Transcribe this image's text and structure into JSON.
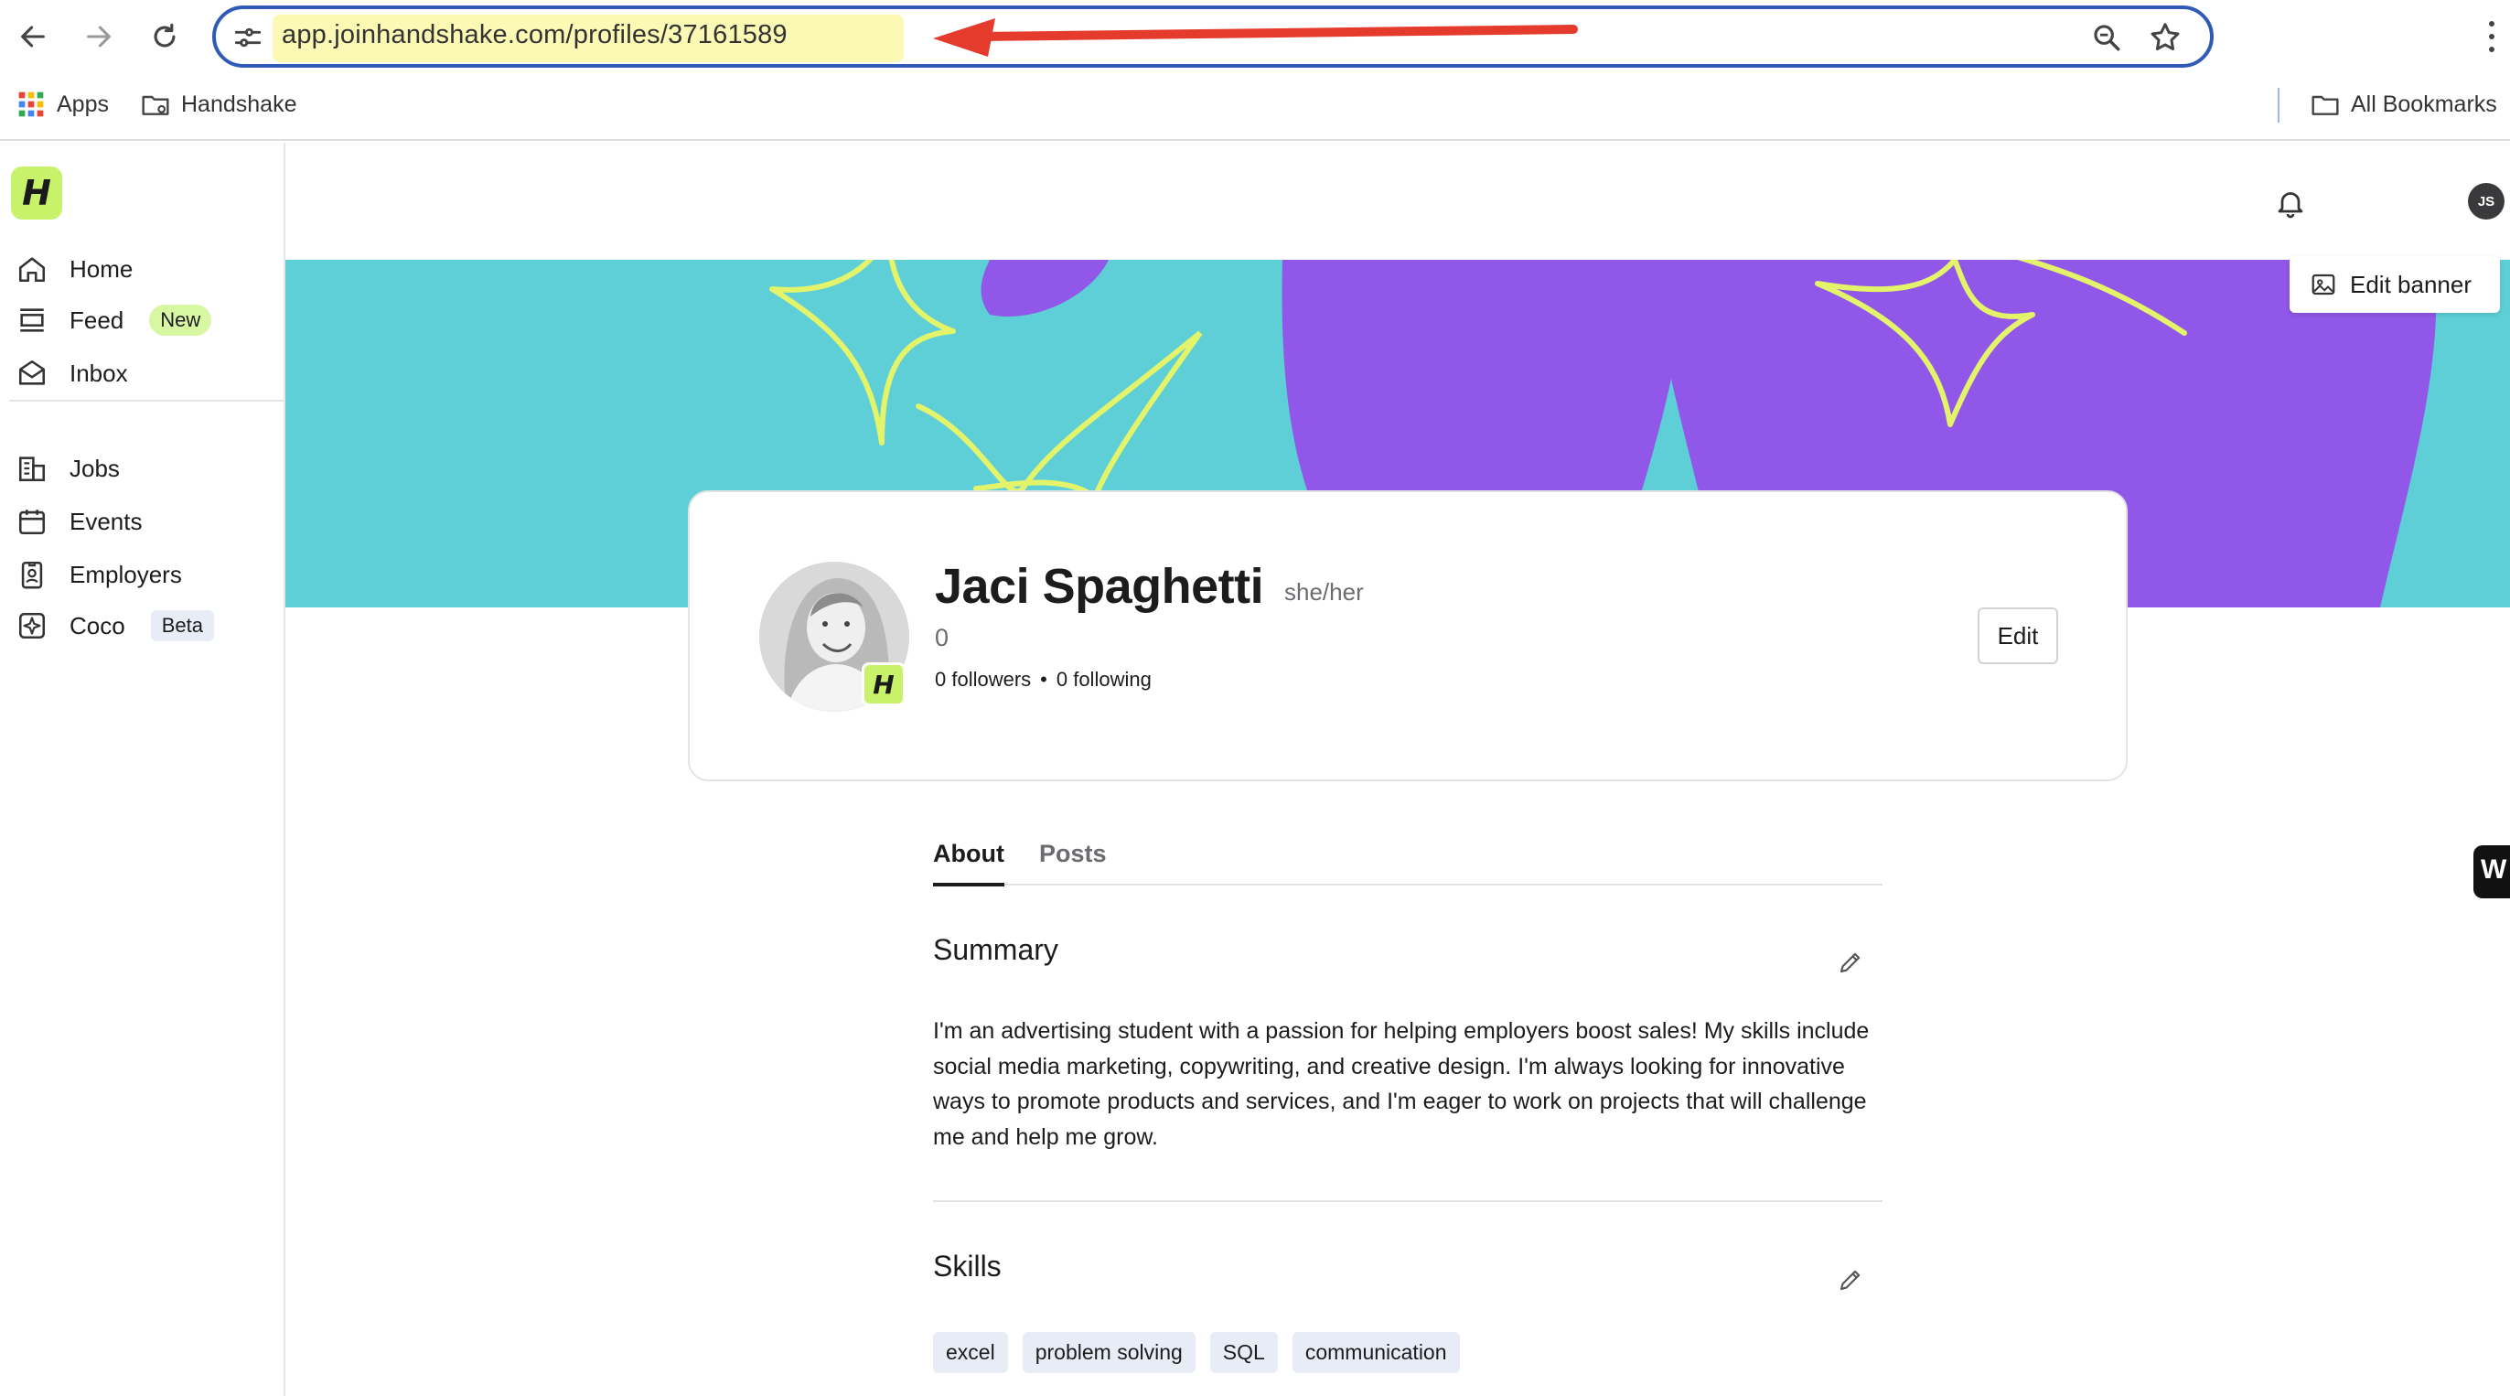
{
  "browser": {
    "url": "app.joinhandshake.com/profiles/37161589",
    "bookmarks": [
      {
        "label": "Apps",
        "icon": "apps-grid-icon"
      },
      {
        "label": "Handshake",
        "icon": "folder-icon"
      }
    ],
    "all_bookmarks_label": "All Bookmarks"
  },
  "app": {
    "logo_letter": "H",
    "brand_color": "#c9f26b",
    "nav": [
      {
        "label": "Home",
        "icon": "home-icon"
      },
      {
        "label": "Feed",
        "icon": "feed-icon",
        "badge": "New"
      },
      {
        "label": "Inbox",
        "icon": "inbox-icon"
      },
      {
        "label": "Jobs",
        "icon": "building-icon"
      },
      {
        "label": "Events",
        "icon": "calendar-icon"
      },
      {
        "label": "Employers",
        "icon": "badge-icon"
      },
      {
        "label": "Coco",
        "icon": "coco-icon",
        "badge": "Beta"
      }
    ],
    "user_initials": "JS"
  },
  "banner": {
    "edit_label": "Edit banner",
    "colors": {
      "background": "#5ecfd7",
      "shape": "#9157e8",
      "sparkle": "#e3f36a"
    }
  },
  "profile": {
    "name": "Jaci Spaghetti",
    "pronouns": "she/her",
    "headline": "0",
    "followers": "0 followers",
    "separator": "•",
    "following": "0 following",
    "edit_label": "Edit"
  },
  "tabs": [
    {
      "label": "About",
      "active": true
    },
    {
      "label": "Posts",
      "active": false
    }
  ],
  "summary": {
    "title": "Summary",
    "text": "I'm an advertising student with a passion for helping employers boost sales! My skills include social media marketing, copywriting, and creative design. I'm always looking for innovative ways to promote products and services, and I'm eager to work on projects that will challenge me and help me grow."
  },
  "skills": {
    "title": "Skills",
    "items": [
      "excel",
      "problem solving",
      "SQL",
      "communication"
    ]
  },
  "side_widget_letter": "W"
}
